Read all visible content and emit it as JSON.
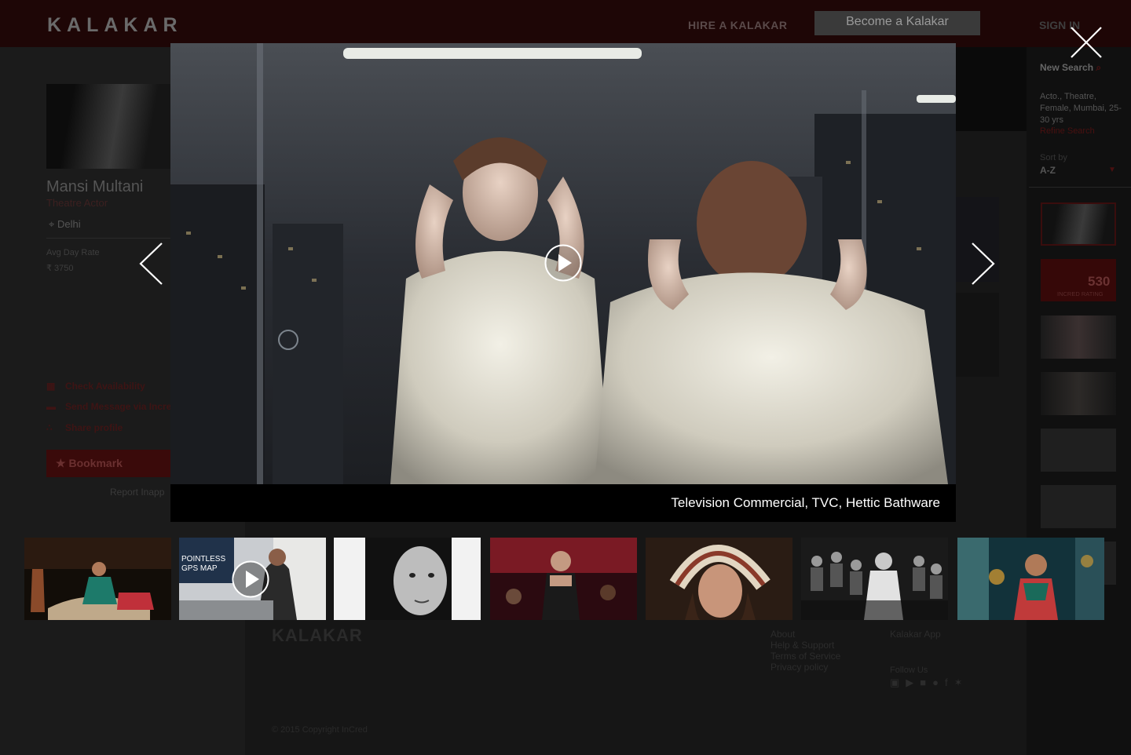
{
  "header": {
    "logo": "KALAKAR",
    "hire_link": "HIRE A KALAKAR",
    "become_button": "Become a Kalakar",
    "signin_link": "SIGN IN"
  },
  "profile": {
    "name": "Mansi Multani",
    "role": "Theatre Actor",
    "location": "Delhi",
    "rate_label": "Avg Day Rate",
    "rate_value": "₹ 3750",
    "actions": {
      "availability": "Check Availability",
      "message": "Send Message via Incre",
      "share": "Share profile"
    },
    "bookmark_label": "Bookmark",
    "report_link": "Report Inapp"
  },
  "sidebar": {
    "new_search": "New Search",
    "criteria": "Acto., Theatre, Female, Mumbai, 25-30 yrs",
    "refine": "Refine Search",
    "sort_label": "Sort by",
    "sort_value": "A-Z",
    "rating_value": "530",
    "rating_label": "INCRED RATING"
  },
  "lightbox": {
    "caption": "Television Commercial, TVC, Hettic Bathware",
    "thumb2_text": "POINTLESS GPS MAP"
  },
  "footer": {
    "logo": "KALAKAR",
    "links": [
      "About",
      "Help & Support",
      "Terms of Service",
      "Privacy policy"
    ],
    "apps": "Kalakar App",
    "follow": "Follow Us",
    "copyright": "© 2015 Copyright InCred"
  },
  "colors": {
    "brand_dark_red": "#1e0606",
    "accent_red": "#3a0a0a",
    "overlay_bg": "#000000",
    "caption_text": "#ffffff"
  },
  "icons": [
    "close-icon",
    "prev-arrow-icon",
    "next-arrow-icon",
    "play-icon",
    "calendar-icon",
    "message-icon",
    "share-icon",
    "location-pin-icon",
    "star-icon",
    "search-icon"
  ]
}
